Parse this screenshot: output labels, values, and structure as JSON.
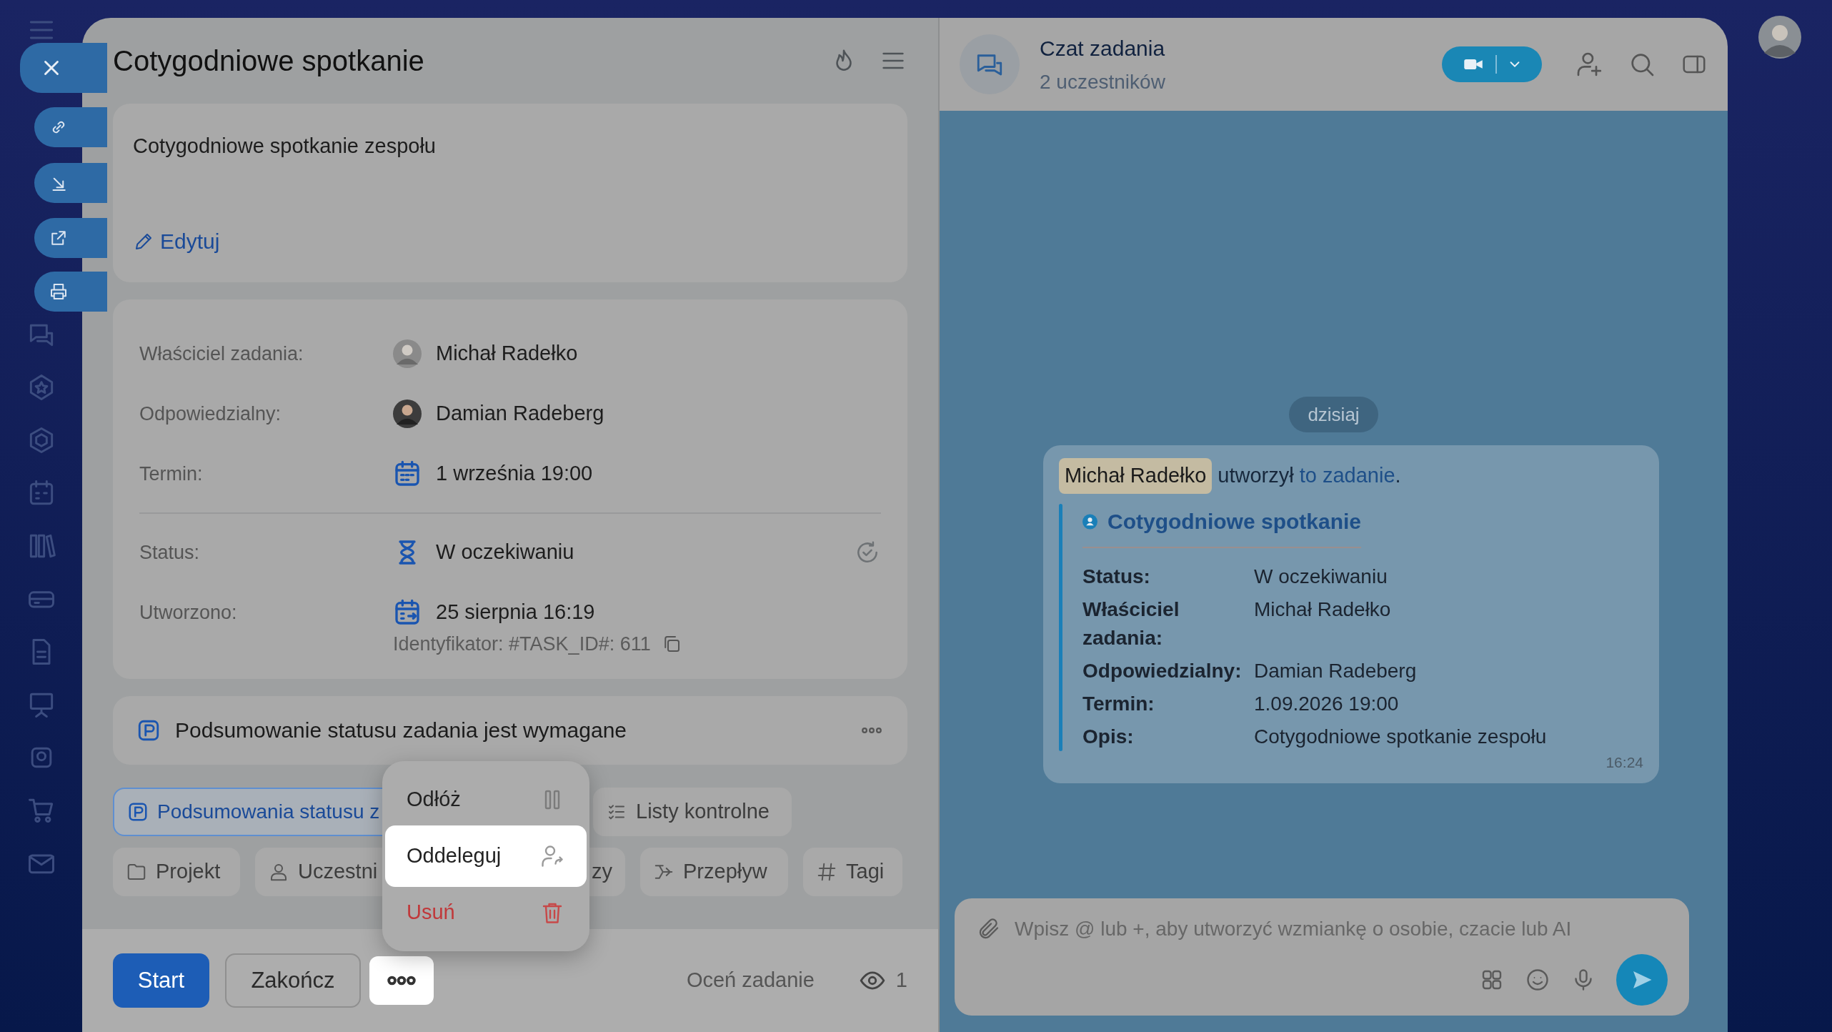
{
  "task": {
    "title": "Cotygodniowe spotkanie",
    "description": "Cotygodniowe spotkanie zespołu",
    "edit_link": "Edytuj",
    "fields": [
      {
        "label": "Właściciel zadania:",
        "value": "Michał Radełko",
        "kind": "person"
      },
      {
        "label": "Odpowiedzialny:",
        "value": "Damian Radeberg",
        "kind": "person"
      },
      {
        "label": "Termin:",
        "value": "1 września 19:00",
        "kind": "deadline"
      },
      {
        "label": "Status:",
        "value": "W oczekiwaniu",
        "kind": "status"
      },
      {
        "label": "Utworzono:",
        "value": "25 sierpnia 16:19",
        "kind": "created"
      }
    ],
    "identifier": "Identyfikator: #TASK_ID#: 611",
    "summary_notice": "Podsumowanie statusu zadania jest wymagane",
    "chip_rows": [
      [
        {
          "label": "Podsumowania statusu z",
          "kind": "summary",
          "selected": true
        },
        {
          "label": "Listy kontrolne",
          "kind": "checklist",
          "selected": false
        }
      ],
      [
        {
          "label": "Projekt",
          "kind": "project",
          "selected": false
        },
        {
          "label": "Uczestni",
          "kind": "participants",
          "selected": false
        },
        {
          "label": "zy",
          "kind": "plain",
          "selected": false
        },
        {
          "label": "Przepływ",
          "kind": "flow",
          "selected": false
        },
        {
          "label": "Tagi",
          "kind": "tags",
          "selected": false
        }
      ]
    ],
    "menu": [
      {
        "label": "Odłóż",
        "kind": "pause",
        "selected": false
      },
      {
        "label": "Oddeleguj",
        "kind": "delegate",
        "selected": true
      },
      {
        "label": "Usuń",
        "kind": "delete",
        "selected": false
      }
    ],
    "footer": {
      "start": "Start",
      "finish": "Zakończ",
      "rate": "Oceń zadanie",
      "views": "1"
    }
  },
  "chat": {
    "title": "Czat zadania",
    "subtitle": "2 uczestników",
    "date": "dzisiaj",
    "message": {
      "author": "Michał Radełko",
      "action": "utworzył",
      "link": "to zadanie",
      "end": ".",
      "card_title": "Cotygodniowe spotkanie",
      "fields": [
        {
          "label": "Status:",
          "value": "W oczekiwaniu"
        },
        {
          "label": "Właściciel zadania:",
          "value": "Michał Radełko"
        },
        {
          "label": "Odpowiedzialny:",
          "value": "Damian Radeberg"
        },
        {
          "label": "Termin:",
          "value": "1.09.2026 19:00"
        },
        {
          "label": "Opis:",
          "value": "Cotygodniowe spotkanie zespołu"
        }
      ],
      "time": "16:24"
    },
    "input_placeholder": "Wpisz @ lub +, aby utworzyć wzmiankę o osobie, czacie lub AI"
  }
}
